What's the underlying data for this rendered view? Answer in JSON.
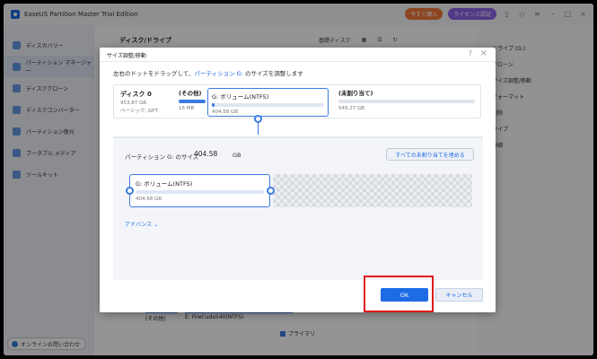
{
  "app": {
    "title": "EaseUS Partition Master Trial Edition",
    "buy_label": "今すぐ購入",
    "license_label": "ライセンス認証"
  },
  "sidebar": {
    "items": [
      {
        "label": "ディスカバリー"
      },
      {
        "label": "パーティション マネージャー"
      },
      {
        "label": "ディスククローン"
      },
      {
        "label": "ディスクコンバーター"
      },
      {
        "label": "パーティション復元"
      },
      {
        "label": "ブータブル メディア"
      },
      {
        "label": "ツールキット"
      }
    ],
    "contact_label": "オンラインお問い合わせ"
  },
  "main": {
    "heading": "ディスク/ドライブ",
    "tool_label": "基礎ディスク"
  },
  "right_panel": {
    "items": [
      {
        "label": "ドライブ (G:)"
      },
      {
        "label": "クローン"
      },
      {
        "label": "サイズ調整/移動"
      },
      {
        "label": "フォーマット"
      },
      {
        "label": "削除"
      },
      {
        "label": "ワイプ"
      },
      {
        "label": "詳細"
      }
    ]
  },
  "background_disk": {
    "other_label": "(その他)",
    "drive_label": "E: FireCuda540(NTFS)",
    "primary_label": "プライマリ"
  },
  "dialog": {
    "title": "サイズ調整/移動",
    "help": "?",
    "close": "×",
    "instruction_pre": "左右のドットをドラッグして、",
    "instruction_hl": "パーティション G:",
    "instruction_post": " のサイズを調整します",
    "disk": {
      "name": "ディスク 0",
      "size": "953.87 GB",
      "type": "ベーシック, GPT"
    },
    "partitions": [
      {
        "name": "(その他)",
        "size": "16 MB"
      },
      {
        "name": "G: ボリューム(NTFS)",
        "size": "404.58 GB"
      },
      {
        "name": "(未割り当て)",
        "size": "549.27 GB"
      }
    ],
    "size_label": "パーティション G: のサイズ",
    "size_value": "404.58",
    "size_unit": "GB",
    "fill_button": "すべての未割り当てを埋める",
    "slider_partition": {
      "name": "G: ボリューム(NTFS)",
      "size": "404.58 GB"
    },
    "advanced_label": "アドバンス",
    "ok_label": "OK",
    "cancel_label": "キャンセル"
  },
  "colors": {
    "accent": "#1e6be6",
    "highlight": "#e01a1a"
  }
}
